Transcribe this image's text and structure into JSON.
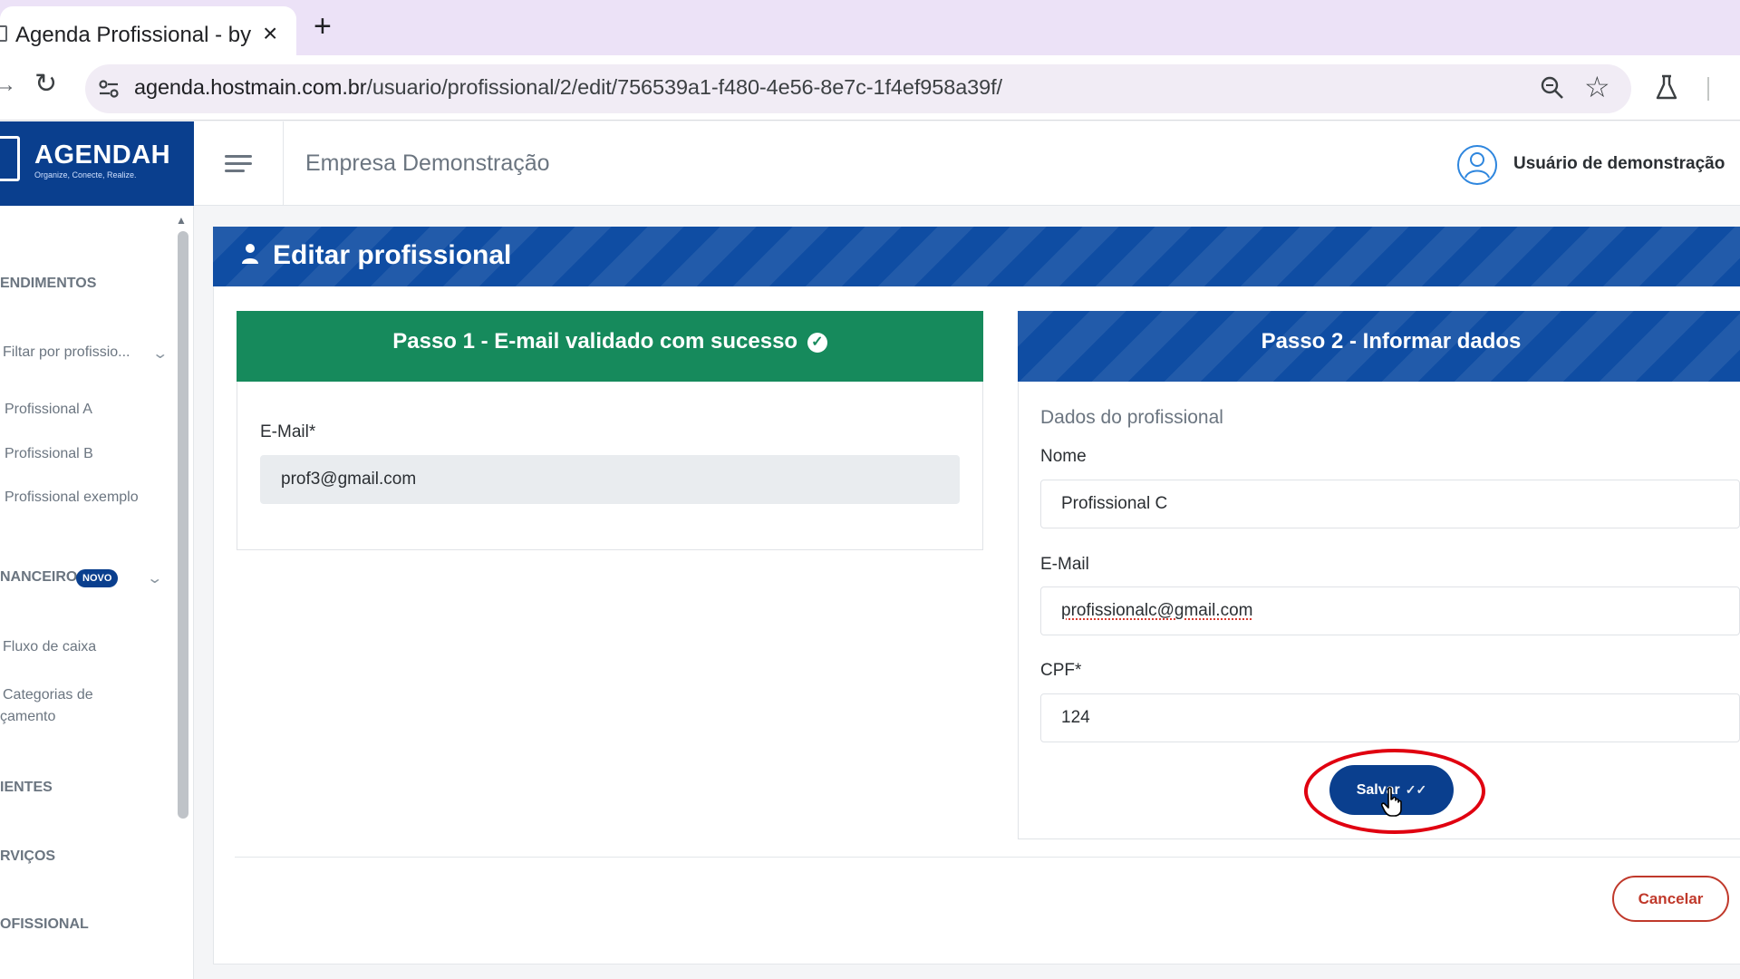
{
  "browser": {
    "tab_title": "Agenda Profissional - by",
    "tab_close": "×",
    "new_tab": "+",
    "url_host": "agenda.hostmain.com.br",
    "url_path": "/usuario/profissional/2/edit/756539a1-f480-4e56-8e7c-1f4ef958a39f/"
  },
  "brand": {
    "name": "AGENDAH",
    "tagline": "Organize, Conecte, Realize."
  },
  "header": {
    "company": "Empresa Demonstração",
    "user_name": "Usuário de demonstração"
  },
  "sidebar": {
    "sections": {
      "atendimentos": "ENDIMENTOS",
      "financeiro": "NANCEIRO",
      "clientes": "IENTES",
      "servicos": "RVIÇOS",
      "profissional": "OFISSIONAL"
    },
    "filter_label": "Filtar por profissio...",
    "professionals": [
      "Profissional A",
      "Profissional B",
      "Profissional exemplo"
    ],
    "badge_new": "NOVO",
    "finance_items": [
      "Fluxo de caixa",
      "Categorias de",
      "çamento"
    ]
  },
  "page": {
    "title": "Editar profissional"
  },
  "step1": {
    "title": "Passo 1 - E-mail validado com sucesso",
    "email_label": "E-Mail*",
    "email_value": "prof3@gmail.com"
  },
  "step2": {
    "title": "Passo 2 - Informar dados",
    "subtitle": "Dados do profissional",
    "name_label": "Nome",
    "name_value": "Profissional C",
    "email_label": "E-Mail",
    "email_value": "profissionalc@gmail.com",
    "cpf_label": "CPF*",
    "cpf_value": "124"
  },
  "actions": {
    "save_label": "Salvar",
    "cancel_label": "Cancelar"
  },
  "colors": {
    "primary": "#0a3f8e",
    "success": "#168a5c",
    "danger": "#c0392b",
    "highlight": "#e00010"
  }
}
